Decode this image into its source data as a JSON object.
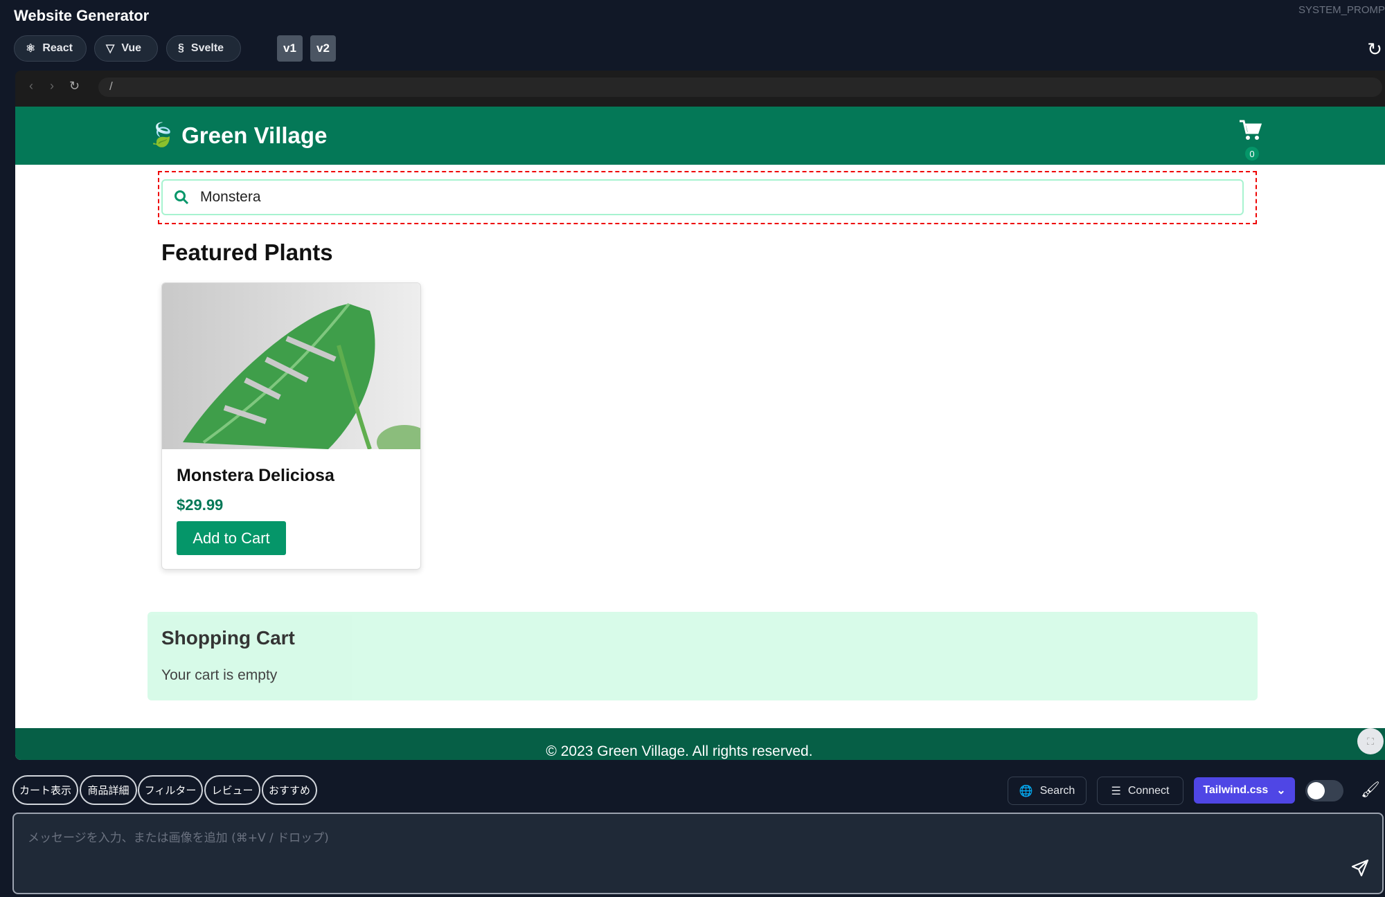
{
  "app": {
    "title": "Website Generator",
    "system_prompt_label": "SYSTEM_PROMP"
  },
  "frameworks": [
    {
      "label": "React",
      "icon": "react-icon"
    },
    {
      "label": "Vue",
      "icon": "vue-icon"
    },
    {
      "label": "Svelte",
      "icon": "svelte-icon"
    }
  ],
  "versions": [
    "v1",
    "v2"
  ],
  "browser": {
    "url": "/"
  },
  "site": {
    "brand": "Green Village",
    "cart_count": "0",
    "search": {
      "value": "Monstera"
    },
    "featured_heading": "Featured Plants",
    "products": [
      {
        "name": "Monstera Deliciosa",
        "price": "$29.99",
        "button": "Add to Cart"
      }
    ],
    "cart": {
      "heading": "Shopping Cart",
      "empty": "Your cart is empty"
    },
    "footer": "© 2023 Green Village. All rights reserved.",
    "colors": {
      "primary": "#047857",
      "button": "#059669",
      "cart_bg": "#d1fae5"
    }
  },
  "chips": [
    "カート表示",
    "商品詳細",
    "フィルター",
    "レビュー",
    "おすすめ"
  ],
  "toolbar": {
    "search": "Search",
    "connect": "Connect",
    "css_select": "Tailwind.css",
    "toggle_on": false
  },
  "composer": {
    "placeholder": "メッセージを入力、または画像を追加 (⌘+V / ドロップ)"
  }
}
